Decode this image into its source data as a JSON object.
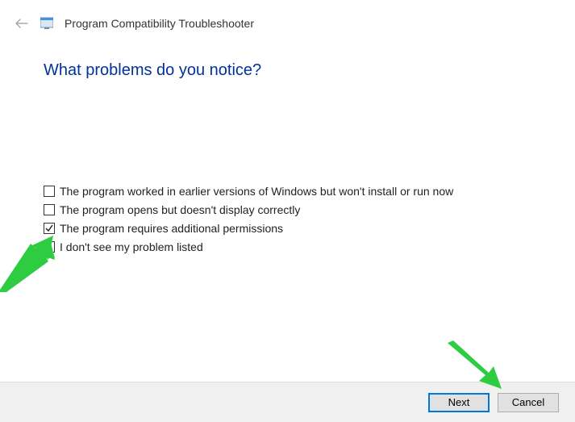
{
  "header": {
    "title": "Program Compatibility Troubleshooter"
  },
  "question": "What problems do you notice?",
  "options": [
    {
      "label": "The program worked in earlier versions of Windows but won't install or run now",
      "checked": false
    },
    {
      "label": "The program opens but doesn't display correctly",
      "checked": false
    },
    {
      "label": "The program requires additional permissions",
      "checked": true
    },
    {
      "label": "I don't see my problem listed",
      "checked": false
    }
  ],
  "buttons": {
    "next": "Next",
    "cancel": "Cancel"
  },
  "annotations": {
    "arrow_color": "#2ecc40"
  }
}
